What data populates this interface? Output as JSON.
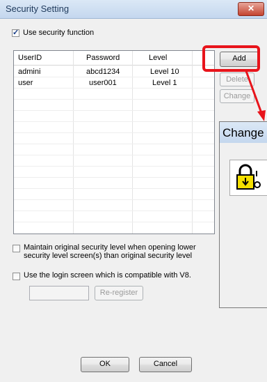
{
  "window": {
    "title": "Security Setting",
    "close_glyph": "✕"
  },
  "use_security": {
    "label": "Use security function",
    "checked": true
  },
  "table": {
    "headers": [
      "UserID",
      "Password",
      "Level"
    ],
    "rows": [
      [
        "admini",
        "abcd1234",
        "Level 10"
      ],
      [
        "user",
        "user001",
        "Level 1"
      ]
    ]
  },
  "buttons": {
    "add": "Add",
    "delete": "Delete",
    "change": "Change",
    "ok": "OK",
    "cancel": "Cancel",
    "reregister": "Re-register"
  },
  "maintain": {
    "line1": "Maintain original security level when opening lower",
    "line2": "security level screen(s) than original security level",
    "checked": false
  },
  "login_compat": {
    "label": "Use the login screen which is compatible with V8.",
    "checked": false
  },
  "popup": {
    "title": "Change"
  },
  "colors": {
    "highlight": "#e8141b",
    "check": "#1a3f88"
  },
  "icons": {
    "lock": "lock-icon",
    "arrow": "red-arrow-icon"
  }
}
